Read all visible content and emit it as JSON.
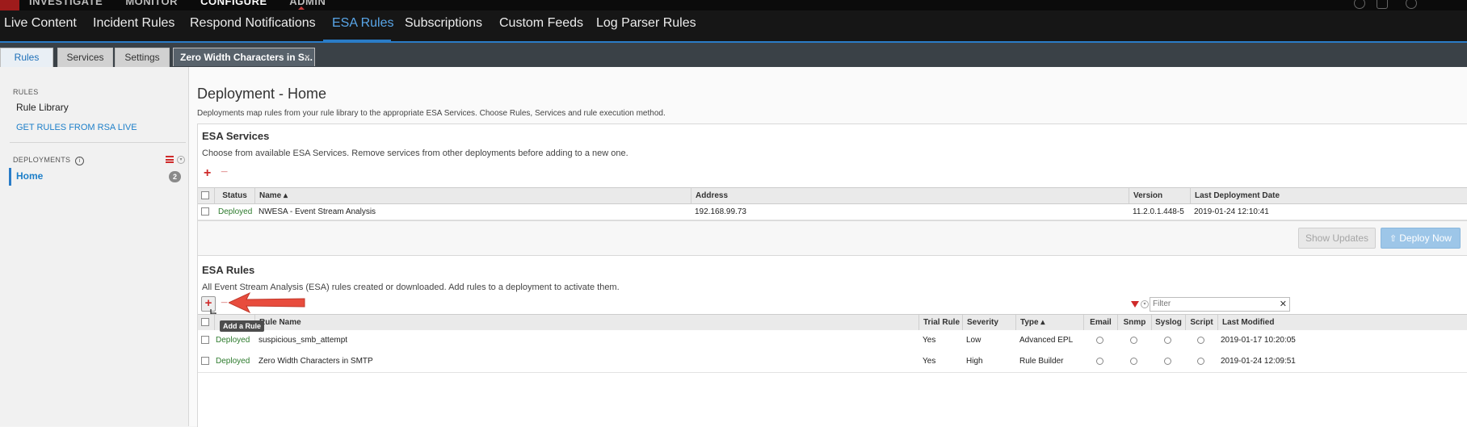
{
  "app": {
    "top_nav": [
      "INVESTIGATE",
      "MONITOR",
      "CONFIGURE",
      "ADMIN"
    ],
    "main_nav": [
      {
        "label": "Live Content"
      },
      {
        "label": "Incident Rules"
      },
      {
        "label": "Respond Notifications"
      },
      {
        "label": "ESA Rules",
        "active": true
      },
      {
        "label": "Subscriptions"
      },
      {
        "label": "Custom Feeds"
      },
      {
        "label": "Log Parser Rules"
      }
    ],
    "tabs": [
      "Rules",
      "Services",
      "Settings",
      "Zero Width Characters in S..."
    ]
  },
  "sidebar": {
    "rules_heading": "RULES",
    "rule_library": "Rule Library",
    "get_rules": "GET RULES FROM RSA LIVE",
    "deployments_heading": "DEPLOYMENTS",
    "home": "Home",
    "home_count": "2"
  },
  "main": {
    "title": "Deployment - Home",
    "description": "Deployments map rules from your rule library to the appropriate ESA Services. Choose Rules, Services and rule execution method.",
    "services": {
      "heading": "ESA Services",
      "description": "Choose from available ESA Services. Remove services from other deployments before adding to a new one.",
      "columns": [
        "Status",
        "Name",
        "Address",
        "Version",
        "Last Deployment Date"
      ],
      "rows": [
        {
          "status": "Deployed",
          "name": "NWESA - Event Stream Analysis",
          "address": "192.168.99.73",
          "version": "11.2.0.1.448-5",
          "date": "2019-01-24 12:10:41"
        }
      ],
      "show_updates": "Show Updates",
      "deploy_now": "Deploy Now"
    },
    "rules": {
      "heading": "ESA Rules",
      "description": "All Event Stream Analysis (ESA) rules created or downloaded. Add rules to a deployment to activate them.",
      "filter_placeholder": "Filter",
      "tooltip": "Add a Rule",
      "columns": [
        "Rule Name",
        "Trial Rule",
        "Severity",
        "Type",
        "Email",
        "Snmp",
        "Syslog",
        "Script",
        "Last Modified"
      ],
      "rows": [
        {
          "status": "Deployed",
          "name": "suspicious_smb_attempt",
          "trial": "Yes",
          "severity": "Low",
          "type": "Advanced EPL",
          "modified": "2019-01-17 10:20:05"
        },
        {
          "status": "Deployed",
          "name": "Zero Width Characters in SMTP",
          "trial": "Yes",
          "severity": "High",
          "type": "Rule Builder",
          "modified": "2019-01-24 12:09:51"
        }
      ]
    }
  }
}
